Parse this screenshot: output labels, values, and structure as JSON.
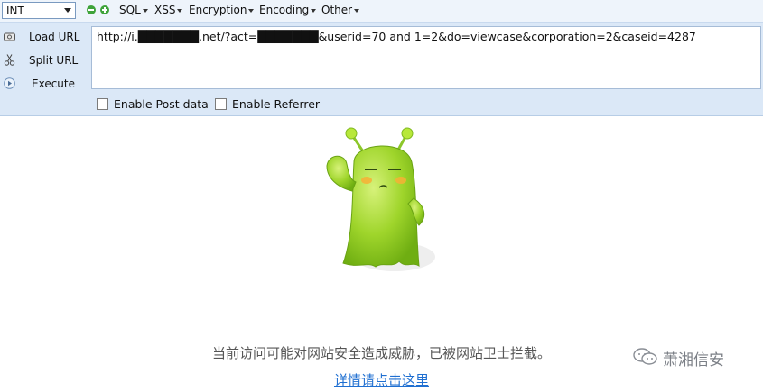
{
  "toolbar": {
    "mode_select": "INT",
    "menus": [
      "SQL",
      "XSS",
      "Encryption",
      "Encoding",
      "Other"
    ]
  },
  "actions": {
    "load": "Load URL",
    "split": "Split URL",
    "execute": "Execute"
  },
  "url_field": {
    "value": "http://i.███████.net/?act=███████&userid=70 and 1=2&do=viewcase&corporation=2&caseid=4287"
  },
  "options": {
    "post": "Enable Post data",
    "referrer": "Enable Referrer"
  },
  "block_page": {
    "message": "当前访问可能对网站安全造成威胁，已被网站卫士拦截。",
    "link": "详情请点击这里"
  },
  "watermark": {
    "text": "萧湘信安"
  },
  "colors": {
    "mascot_green": "#9fd52b",
    "link_blue": "#1f6fd1",
    "panel_blue": "#dbe8f7"
  },
  "icons": [
    "chevron-down-icon",
    "minus-icon",
    "plus-icon",
    "load-icon",
    "scissors-icon",
    "play-icon",
    "mascot-image",
    "wechat-icon"
  ]
}
